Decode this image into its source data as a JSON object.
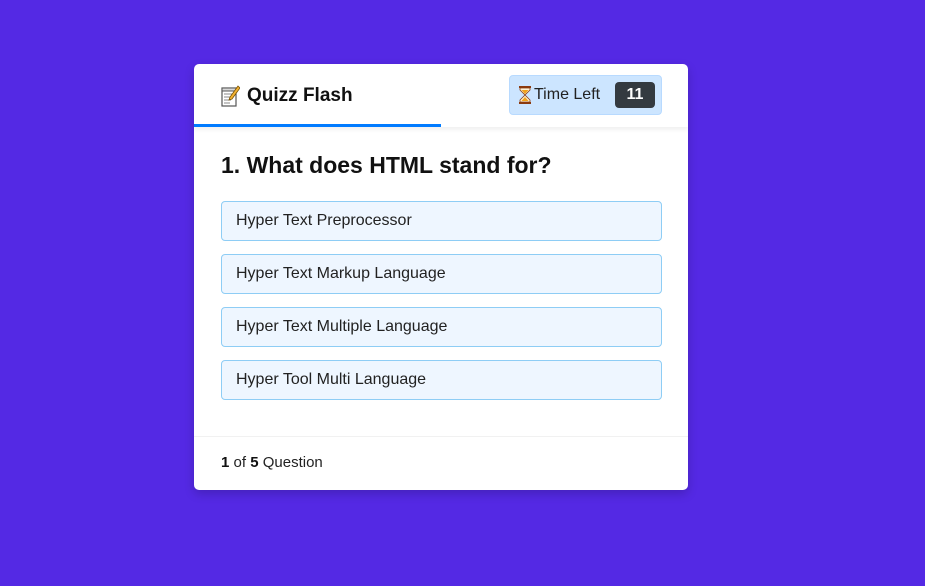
{
  "header": {
    "title": "Quizz Flash",
    "title_icon": "memo-icon",
    "timer": {
      "icon": "hourglass-icon",
      "label": "Time Left",
      "value": "11"
    },
    "progress_fraction": 0.5
  },
  "question": {
    "text": "1. What does HTML stand for?",
    "options": [
      "Hyper Text Preprocessor",
      "Hyper Text Markup Language",
      "Hyper Text Multiple Language",
      "Hyper Tool Multi Language"
    ]
  },
  "footer": {
    "current": "1",
    "of": "of",
    "total": "5",
    "suffix": "Question"
  },
  "colors": {
    "background": "#5429e4",
    "accent": "#007bff",
    "timer_bg": "#cce5ff",
    "timer_value_bg": "#343a40",
    "option_bg": "#eef6ff",
    "option_border": "#8ecdf5"
  }
}
